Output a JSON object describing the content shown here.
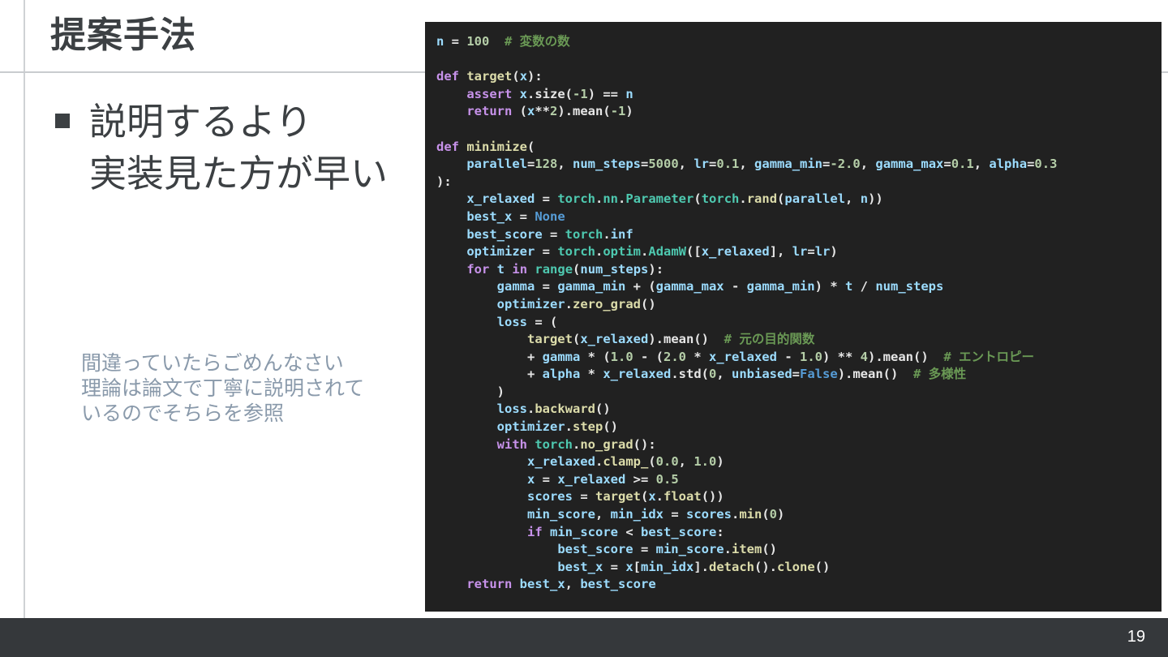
{
  "slide": {
    "title": "提案手法",
    "bullet_line1": "説明するより",
    "bullet_line2": "実装見た方が早い",
    "note_line1": "間違っていたらごめんなさい",
    "note_line2": "理論は論文で丁寧に説明されて",
    "note_line3": "いるのでそちらを参照",
    "page_number": "19"
  },
  "code": {
    "comment_vars": "# 変数の数",
    "comment_orig": "# 元の目的関数",
    "comment_entropy": "# エントロピー",
    "comment_diversity": "# 多様性"
  },
  "colors": {
    "code_bg": "#212121",
    "keyword": "#c792ea",
    "function": "#dcdcaa",
    "variable": "#9cdcfe",
    "number": "#b5cea8",
    "comment": "#6a9955",
    "footer_bg": "#35383b"
  }
}
